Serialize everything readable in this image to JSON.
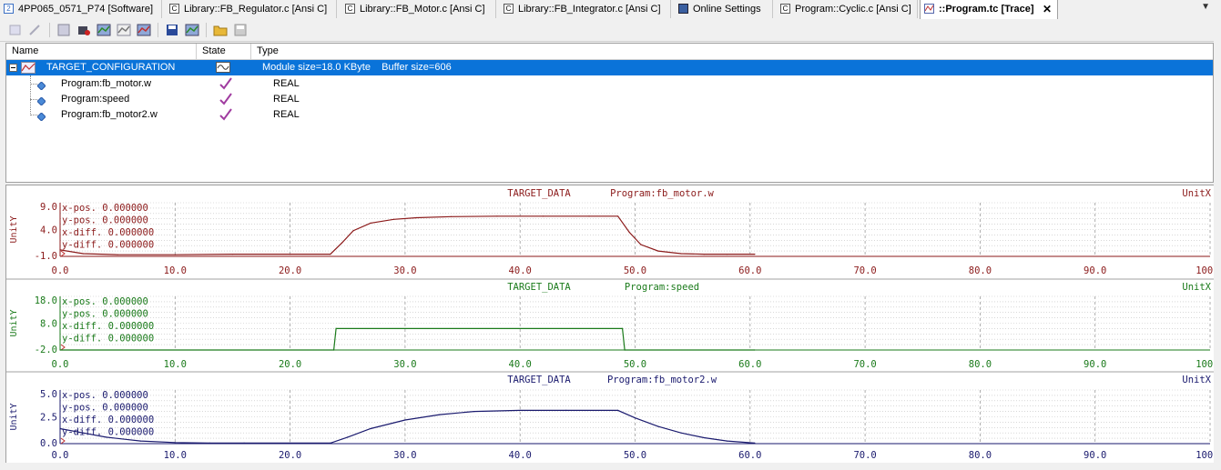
{
  "tabs": [
    {
      "label": "4PP065_0571_P74 [Software]",
      "icon": "project-icon"
    },
    {
      "label": "Library::FB_Regulator.c [Ansi C]",
      "icon": "c-file-icon"
    },
    {
      "label": "Library::FB_Motor.c [Ansi C]",
      "icon": "c-file-icon"
    },
    {
      "label": "Library::FB_Integrator.c [Ansi C]",
      "icon": "c-file-icon"
    },
    {
      "label": "Online Settings",
      "icon": "monitor-icon"
    },
    {
      "label": "Program::Cyclic.c [Ansi C]",
      "icon": "c-file-icon"
    },
    {
      "label": "::Program.tc [Trace]",
      "icon": "trace-icon",
      "active": true
    }
  ],
  "tab_close_symbol": "✕",
  "tree": {
    "columns": [
      "Name",
      "State",
      "Type"
    ],
    "rows": [
      {
        "name": "TARGET_CONFIGURATION",
        "state": "trace-icon",
        "type": "Module size=18.0 KByte    Buffer size=606",
        "selected": true
      },
      {
        "name": "Program:fb_motor.w",
        "state": "check-icon",
        "type": "REAL"
      },
      {
        "name": "Program:speed",
        "state": "check-icon",
        "type": "REAL"
      },
      {
        "name": "Program:fb_motor2.w",
        "state": "check-icon",
        "type": "REAL"
      }
    ]
  },
  "charts": {
    "cursor_labels": [
      "x-pos.  0.000000",
      "y-pos.  0.000000",
      "x-diff. 0.000000",
      "y-diff. 0.000000"
    ],
    "unit_x": "UnitX",
    "unit_y": "UnitY",
    "source": "TARGET_DATA"
  },
  "chart_data": [
    {
      "type": "line",
      "title": "Program:fb_motor.w",
      "color": "#8b1a1a",
      "ylim": [
        -1.0,
        9.0
      ],
      "y_ticks": [
        "9.0",
        "4.0",
        "-1.0"
      ],
      "xlim": [
        0,
        100
      ],
      "x_ticks": [
        "0.0",
        "10.0",
        "20.0",
        "30.0",
        "40.0",
        "50.0",
        "60.0",
        "70.0",
        "80.0",
        "90.0",
        "100.0"
      ],
      "x": [
        0,
        2,
        5,
        10,
        15,
        20,
        23.5,
        24.5,
        25.5,
        27,
        29,
        31,
        34,
        38,
        42,
        46,
        48.5,
        49.5,
        50.5,
        52,
        54,
        56,
        58,
        60.4
      ],
      "y": [
        0.2,
        -0.5,
        -0.7,
        -0.7,
        -0.6,
        -0.6,
        -0.6,
        1.5,
        3.8,
        5.2,
        5.9,
        6.2,
        6.4,
        6.5,
        6.5,
        6.5,
        6.5,
        3.5,
        1.2,
        0.0,
        -0.5,
        -0.6,
        -0.6,
        -0.6
      ]
    },
    {
      "type": "line",
      "title": "Program:speed",
      "color": "#1a7a1a",
      "ylim": [
        -2.0,
        18.0
      ],
      "y_ticks": [
        "18.0",
        "8.0",
        "-2.0"
      ],
      "xlim": [
        0,
        100
      ],
      "x_ticks": [
        "0.0",
        "10.0",
        "20.0",
        "30.0",
        "40.0",
        "50.0",
        "60.0",
        "70.0",
        "80.0",
        "90.0",
        "100.0"
      ],
      "x": [
        0,
        23.8,
        24.0,
        48.9,
        49.1,
        60.4
      ],
      "y": [
        -2.0,
        -2.0,
        6.0,
        6.0,
        -2.0,
        -2.0
      ]
    },
    {
      "type": "line",
      "title": "Program:fb_motor2.w",
      "color": "#1a1a6e",
      "ylim": [
        0.0,
        5.0
      ],
      "y_ticks": [
        "5.0",
        "2.5",
        "0.0"
      ],
      "xlim": [
        0,
        100
      ],
      "x_ticks": [
        "0.0",
        "10.0",
        "20.0",
        "30.0",
        "40.0",
        "50.0",
        "60.0",
        "70.0",
        "80.0",
        "90.0",
        "100.0"
      ],
      "x": [
        0,
        2,
        4,
        7,
        10,
        13,
        16,
        20,
        23.5,
        25,
        27,
        30,
        33,
        36,
        40,
        44,
        48.5,
        50,
        52,
        54,
        56,
        58,
        60.4
      ],
      "y": [
        1.4,
        1.0,
        0.6,
        0.25,
        0.1,
        0.05,
        0.05,
        0.05,
        0.05,
        0.6,
        1.4,
        2.2,
        2.7,
        3.0,
        3.1,
        3.1,
        3.1,
        2.4,
        1.6,
        1.0,
        0.55,
        0.25,
        0.05
      ]
    }
  ]
}
